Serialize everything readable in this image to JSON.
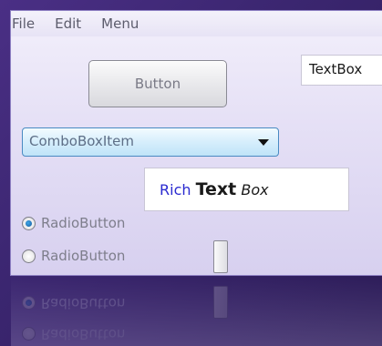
{
  "menu": {
    "items": [
      "File",
      "Edit",
      "Menu"
    ]
  },
  "controls": {
    "button_label": "Button",
    "textbox_value": "TextBox",
    "combobox_value": "ComboBoxItem",
    "richtext": {
      "part1": "Rich",
      "part2": "Text",
      "part3": "Box"
    },
    "radio_buttons": [
      {
        "label": "RadioButton",
        "checked": true
      },
      {
        "label": "RadioButton",
        "checked": false
      }
    ]
  },
  "colors": {
    "background": "#3b2670",
    "window": "#e6e1f6",
    "accent_blue": "#2a2ad0"
  }
}
